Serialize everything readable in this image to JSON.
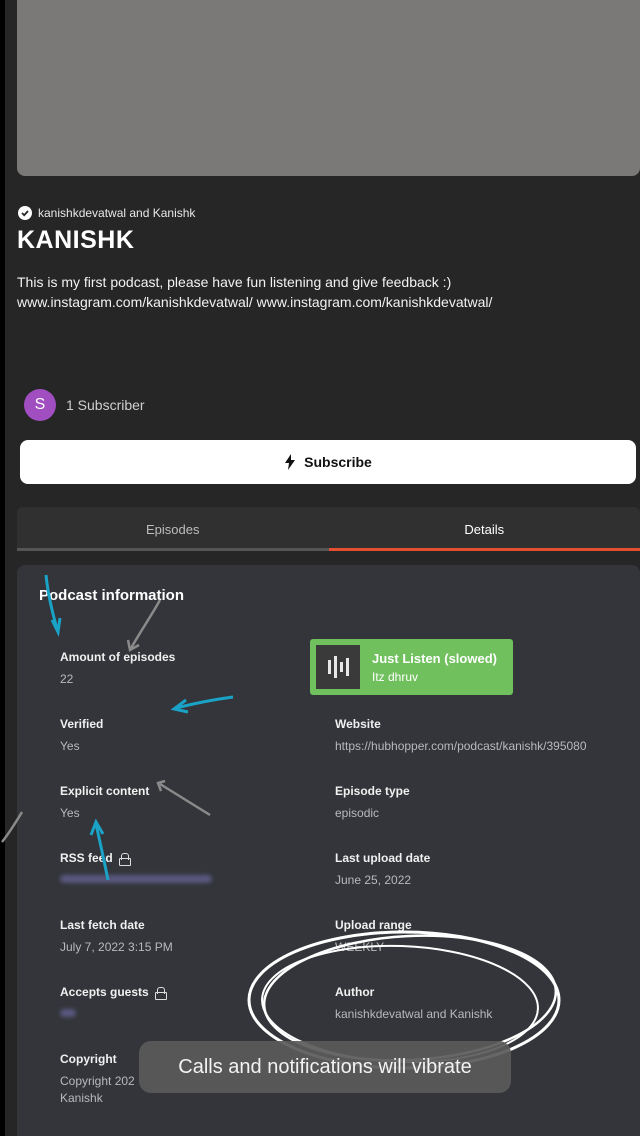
{
  "podcast": {
    "author_line": "kanishkdevatwal and Kanishk",
    "title": "KANISHK",
    "description": "This is my first podcast, please have fun listening and give feedback :) www.instagram.com/kanishkdevatwal/ www.instagram.com/kanishkdevatwal/",
    "avatar_letter": "S",
    "subscribers": "1 Subscriber",
    "subscribe_label": "Subscribe"
  },
  "tabs": [
    {
      "label": "Episodes"
    },
    {
      "label": "Details"
    }
  ],
  "info": {
    "title": "Podcast information",
    "episodes_label": "Amount of episodes",
    "episodes_value": "22",
    "verified_label": "Verified",
    "verified_value": "Yes",
    "website_label": "Website",
    "website_value": "https://hubhopper.com/podcast/kanishk/395080",
    "explicit_label": "Explicit content",
    "explicit_value": "Yes",
    "episode_type_label": "Episode type",
    "episode_type_value": "episodic",
    "rss_label": "RSS feed",
    "last_upload_label": "Last upload date",
    "last_upload_value": "June 25, 2022",
    "last_fetch_label": "Last fetch date",
    "last_fetch_value": "July 7, 2022 3:15 PM",
    "upload_range_label": "Upload range",
    "upload_range_value": "WEEKLY",
    "guests_label": "Accepts guests",
    "author_label": "Author",
    "author_value": "kanishkdevatwal and Kanishk",
    "copyright_label": "Copyright",
    "copyright_value": "Copyright 202",
    "copyright_value2": "Kanishk"
  },
  "now_playing": {
    "title": "Just Listen (slowed)",
    "artist": "Itz dhruv",
    "color": "#71c05e"
  },
  "toast": "Calls and notifications will vibrate",
  "colors": {
    "accent": "#e4502f",
    "avatar": "#a04ec0",
    "annotation_blue": "#1aa3c7"
  }
}
